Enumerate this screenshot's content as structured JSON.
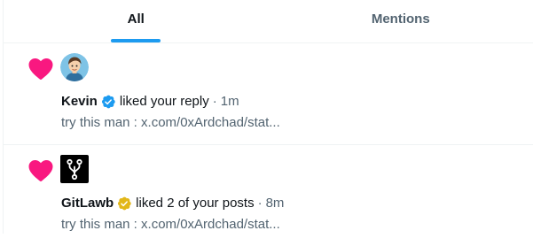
{
  "tabs": [
    {
      "label": "All",
      "active": true
    },
    {
      "label": "Mentions",
      "active": false
    }
  ],
  "colors": {
    "accent": "#1d9bf0",
    "like": "#f91880",
    "verified_blue": "#1d9bf0",
    "verified_gold": "#e2b719",
    "muted_text": "#536471"
  },
  "notifications": [
    {
      "icon": "heart-icon",
      "user": "Kevin",
      "badge": "verified-blue-badge-icon",
      "action": "liked your reply",
      "separator": "·",
      "time": "1m",
      "snippet": "try this man : x.com/0xArdchad/stat..."
    },
    {
      "icon": "heart-icon",
      "user": "GitLawb",
      "badge": "verified-gold-badge-icon",
      "action": "liked 2 of your posts",
      "separator": "·",
      "time": "8m",
      "snippet": "try this man : x.com/0xArdchad/stat..."
    }
  ]
}
